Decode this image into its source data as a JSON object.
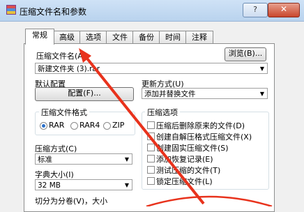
{
  "window": {
    "title": "压缩文件名和参数",
    "help_label": "?",
    "close_label": "✕"
  },
  "tabs": [
    "常规",
    "高级",
    "选项",
    "文件",
    "备份",
    "时间",
    "注释"
  ],
  "general": {
    "archive_name_label": "压缩文件名(A)",
    "browse_label": "浏览(B)...",
    "archive_name_value": "新建文件夹 (3).rar",
    "default_profile_label": "默认配置",
    "profiles_button_label": "配置(F)...",
    "update_mode_label": "更新方式(U)",
    "update_mode_value": "添加并替换文件",
    "archive_format_title": "压缩文件格式",
    "formats": [
      "RAR",
      "RAR4",
      "ZIP"
    ],
    "selected_format": "RAR",
    "compression_method_label": "压缩方式(C)",
    "compression_method_value": "标准",
    "dictionary_size_label": "字典大小(I)",
    "dictionary_size_value": "32 MB",
    "split_label": "切分为分卷(V)，大小",
    "archive_options_title": "压缩选项",
    "options": [
      "压缩后删除原来的文件(D)",
      "创建自解压格式压缩文件(X)",
      "创建固实压缩文件(S)",
      "添加恢复记录(E)",
      "测试压缩的文件(T)",
      "锁定压缩文件(L)"
    ]
  },
  "colors": {
    "arrow": "#e8321c",
    "accent": "#2a6fc9"
  }
}
